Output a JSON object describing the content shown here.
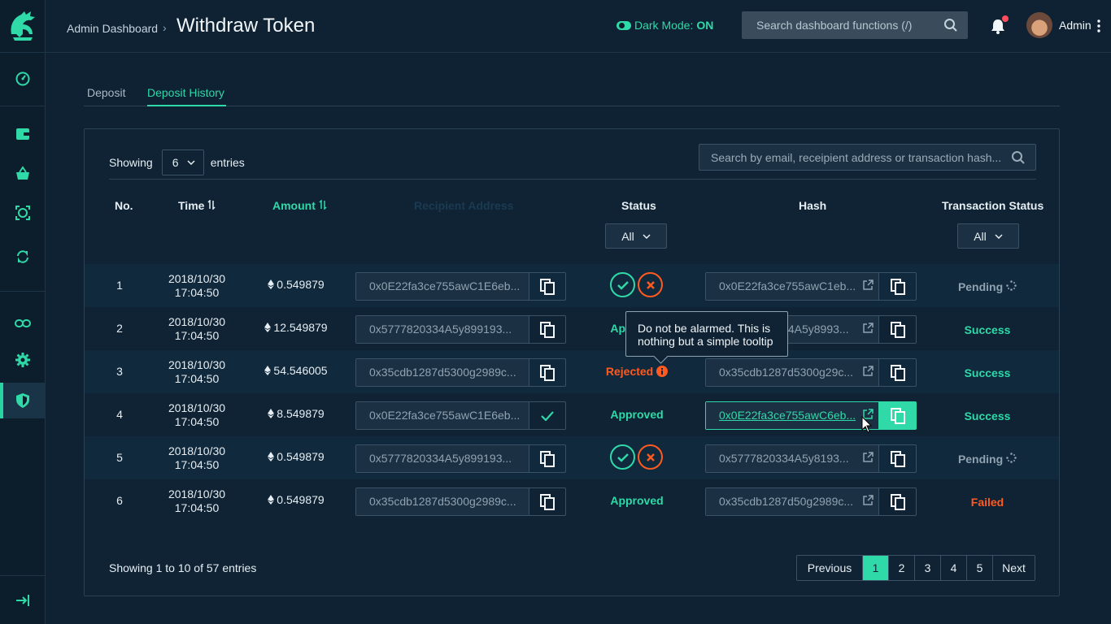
{
  "header": {
    "breadcrumb": "Admin Dashboard",
    "title": "Withdraw Token",
    "dark_mode_label": "Dark Mode:",
    "dark_mode_value": "ON",
    "search_placeholder": "Search dashboard functions (/)",
    "user_name": "Admin"
  },
  "sidebar": {
    "items": [
      {
        "icon": "speedometer-icon"
      },
      {
        "icon": "wallet-icon"
      },
      {
        "icon": "basket-icon"
      },
      {
        "icon": "focus-icon"
      },
      {
        "icon": "sync-icon"
      },
      {
        "icon": "link-icon"
      },
      {
        "icon": "gear-icon"
      },
      {
        "icon": "shield-icon",
        "active": true
      }
    ],
    "collapse_icon": "collapse-icon"
  },
  "tabs": [
    {
      "label": "Deposit"
    },
    {
      "label": "Deposit History",
      "active": true
    }
  ],
  "table": {
    "showing_label": "Showing",
    "entries_value": "6",
    "entries_label": "entries",
    "search_placeholder": "Search by email, receipient address or transaction hash...",
    "columns": {
      "no": "No.",
      "time": "Time",
      "amount": "Amount",
      "recipient": "Recipient Address",
      "status": "Status",
      "hash": "Hash",
      "tx_status": "Transaction Status"
    },
    "status_filter": "All",
    "tx_filter": "All",
    "rows": [
      {
        "no": "1",
        "date": "2018/10/30",
        "time": "17:04:50",
        "amount": "0.549879",
        "address": "0x0E22fa3ce755awC1E6eb...",
        "status": "",
        "hash": "0x0E22fa3ce755awC1eb...",
        "tx_status": "Pending"
      },
      {
        "no": "2",
        "date": "2018/10/30",
        "time": "17:04:50",
        "amount": "12.549879",
        "address": "0x5777820334A5y899193...",
        "status": "Approved",
        "hash": "0x5777820334A5y8993...",
        "tx_status": "Success"
      },
      {
        "no": "3",
        "date": "2018/10/30",
        "time": "17:04:50",
        "amount": "54.546005",
        "address": "0x35cdb1287d5300g2989c...",
        "status": "Rejected",
        "hash": "0x35cdb1287d5300g29c...",
        "tx_status": "Success"
      },
      {
        "no": "4",
        "date": "2018/10/30",
        "time": "17:04:50",
        "amount": "8.549879",
        "address": "0x0E22fa3ce755awC1E6eb...",
        "status": "Approved",
        "hash": "0x0E22fa3ce755awC6eb...",
        "tx_status": "Success"
      },
      {
        "no": "5",
        "date": "2018/10/30",
        "time": "17:04:50",
        "amount": "0.549879",
        "address": "0x5777820334A5y899193...",
        "status": "",
        "hash": "0x5777820334A5y8193...",
        "tx_status": "Pending"
      },
      {
        "no": "6",
        "date": "2018/10/30",
        "time": "17:04:50",
        "amount": "0.549879",
        "address": "0x35cdb1287d5300g2989c...",
        "status": "Approved",
        "hash": "0x35cdb1287d50g2989c...",
        "tx_status": "Failed"
      }
    ],
    "tooltip": "Do not be alarmed. This is nothing but a simple tooltip",
    "footer": "Showing 1 to 10 of 57 entries",
    "pagination": [
      "Previous",
      "1",
      "2",
      "3",
      "4",
      "5",
      "Next"
    ],
    "current_page": "1"
  },
  "colors": {
    "accent": "#2fd9a8",
    "danger": "#ff5a1f",
    "background": "#0e2233"
  }
}
